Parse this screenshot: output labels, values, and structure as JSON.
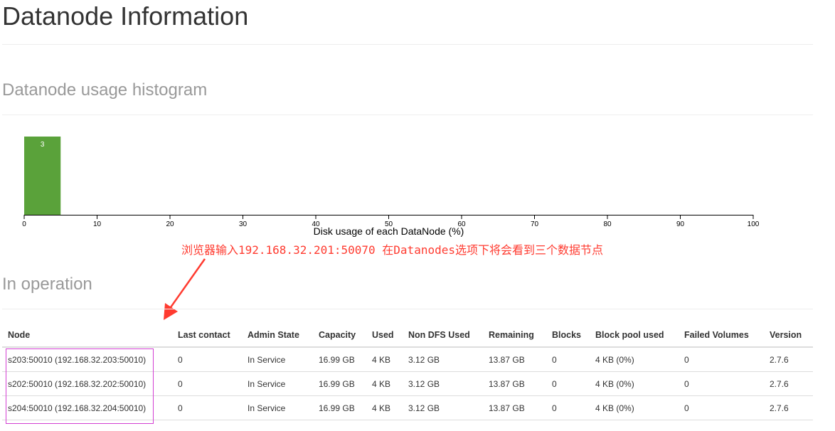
{
  "page": {
    "title": "Datanode Information"
  },
  "histogram_section": {
    "title": "Datanode usage histogram"
  },
  "chart_data": {
    "type": "bar",
    "title": "",
    "xlabel": "Disk usage of each DataNode (%)",
    "ylabel": "",
    "xlim": [
      0,
      100
    ],
    "x_ticks": [
      0,
      10,
      20,
      30,
      40,
      50,
      60,
      70,
      80,
      90,
      100
    ],
    "bins": [
      {
        "x_start": 0,
        "x_end": 5,
        "value": 3,
        "label": "3"
      }
    ],
    "ylim": [
      0,
      3
    ],
    "grid": false,
    "legend": "none",
    "bar_color": "#5aa23a"
  },
  "annotation": {
    "text": "浏览器输入192.168.32.201:50070 在Datanodes选项下将会看到三个数据节点",
    "color": "#ff3b30"
  },
  "operation_section": {
    "title": "In operation",
    "columns": [
      "Node",
      "Last contact",
      "Admin State",
      "Capacity",
      "Used",
      "Non DFS Used",
      "Remaining",
      "Blocks",
      "Block pool used",
      "Failed Volumes",
      "Version"
    ],
    "rows": [
      [
        "s203:50010 (192.168.32.203:50010)",
        "0",
        "In Service",
        "16.99 GB",
        "4 KB",
        "3.12 GB",
        "13.87 GB",
        "0",
        "4 KB (0%)",
        "0",
        "2.7.6"
      ],
      [
        "s202:50010 (192.168.32.202:50010)",
        "0",
        "In Service",
        "16.99 GB",
        "4 KB",
        "3.12 GB",
        "13.87 GB",
        "0",
        "4 KB (0%)",
        "0",
        "2.7.6"
      ],
      [
        "s204:50010 (192.168.32.204:50010)",
        "0",
        "In Service",
        "16.99 GB",
        "4 KB",
        "3.12 GB",
        "13.87 GB",
        "0",
        "4 KB (0%)",
        "0",
        "2.7.6"
      ]
    ]
  }
}
